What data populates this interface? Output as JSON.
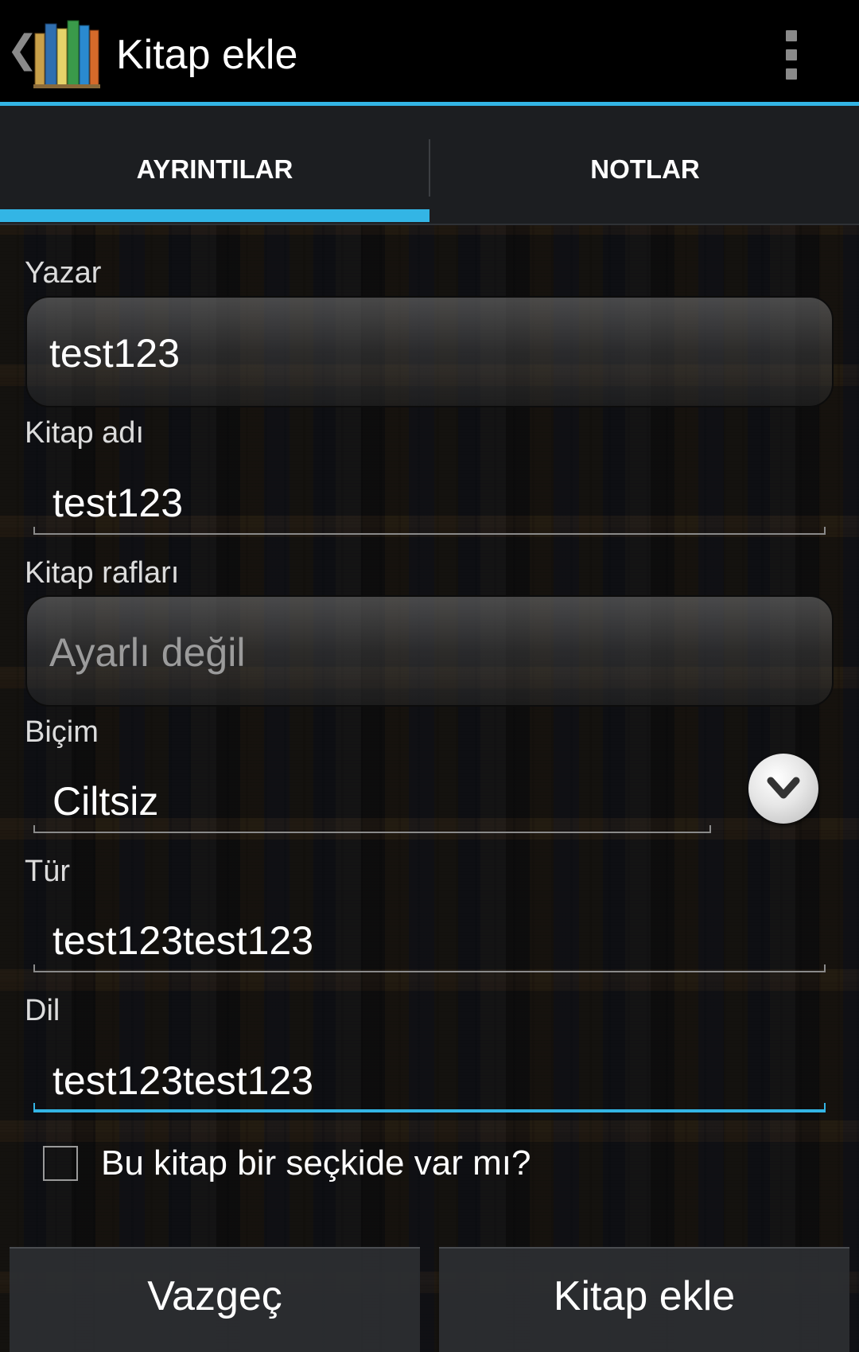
{
  "action_bar": {
    "title": "Kitap ekle",
    "up_icon": "chevron-left-icon",
    "app_icon": "books-icon",
    "overflow_icon": "more-vert-icon",
    "accent_color": "#33b5e5"
  },
  "tabs": [
    {
      "label": "AYRINTILAR",
      "selected": true
    },
    {
      "label": "NOTLAR",
      "selected": false
    }
  ],
  "form": {
    "author": {
      "label": "Yazar",
      "value": "test123"
    },
    "title": {
      "label": "Kitap adı",
      "value": "test123"
    },
    "bookshelves": {
      "label": "Kitap rafları",
      "placeholder": "Ayarlı değil"
    },
    "format": {
      "label": "Biçim",
      "value": "Ciltsiz"
    },
    "genre": {
      "label": "Tür",
      "value": "test123test123"
    },
    "language": {
      "label": "Dil",
      "value": "test123test123"
    },
    "anthology": {
      "label": "Bu kitap bir seçkide var mı?",
      "checked": false
    }
  },
  "buttons": {
    "cancel": "Vazgeç",
    "add": "Kitap ekle"
  }
}
